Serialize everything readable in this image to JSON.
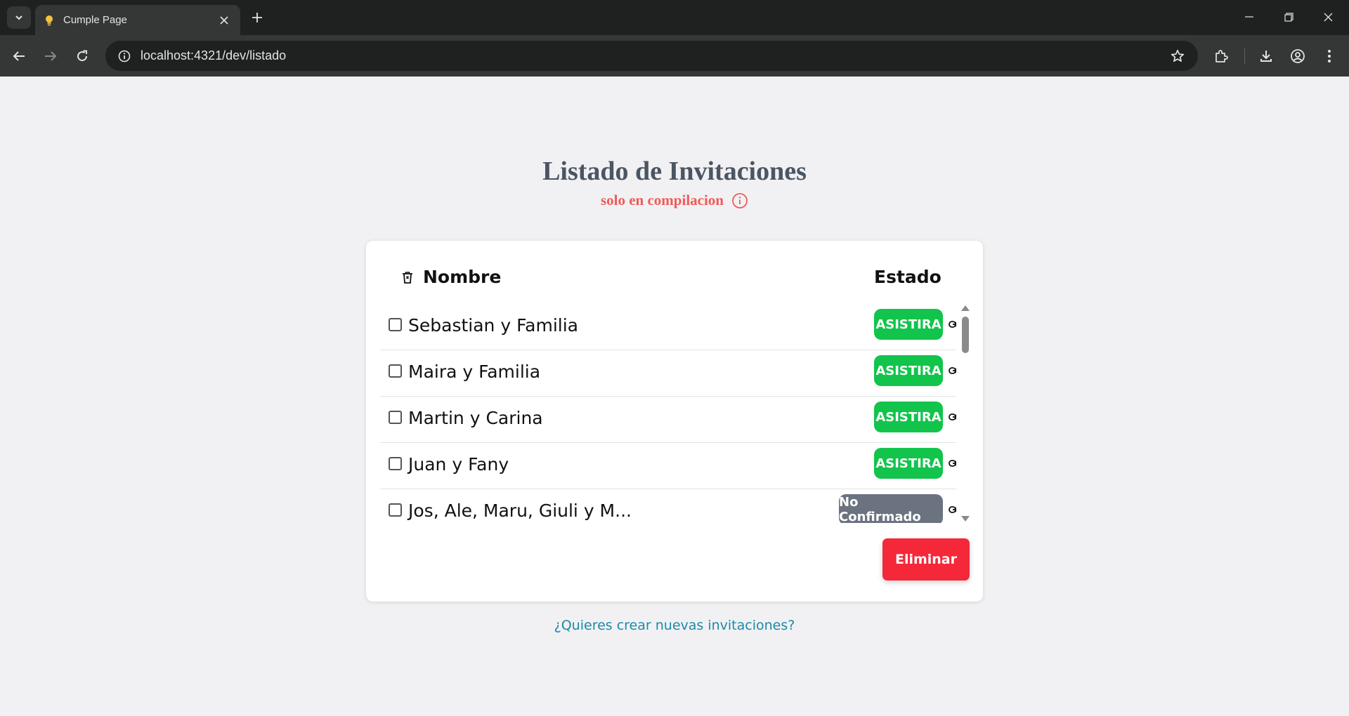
{
  "browser": {
    "tab_title": "Cumple Page",
    "url": "localhost:4321/dev/listado"
  },
  "page": {
    "title": "Listado de Invitaciones",
    "subtitle": "solo en compilacion"
  },
  "table": {
    "headers": {
      "nombre": "Nombre",
      "estado": "Estado"
    },
    "rows": [
      {
        "name": "Sebastian y Familia",
        "status": "ASISTIRA",
        "checked": false
      },
      {
        "name": "Maira y Familia",
        "status": "ASISTIRA",
        "checked": false
      },
      {
        "name": "Martin y Carina",
        "status": "ASISTIRA",
        "checked": false
      },
      {
        "name": "Juan y Fany",
        "status": "ASISTIRA",
        "checked": false
      },
      {
        "name": "Jos, Ale, Maru, Giuli y M...",
        "status": "No Confirmado",
        "checked": false
      }
    ]
  },
  "actions": {
    "delete_label": "Eliminar"
  },
  "footer": {
    "create_link": "¿Quieres crear nuevas invitaciones?"
  },
  "colors": {
    "status_confirmed": "#12c44c",
    "status_pending": "#6b7280",
    "danger": "#f5283a",
    "subtitle": "#f05a5a",
    "link": "#1b8aa8"
  },
  "icons": {
    "favicon": "lightbulb-icon",
    "info": "info-icon",
    "delete_header": "trash-icon",
    "row_link": "link-icon"
  }
}
